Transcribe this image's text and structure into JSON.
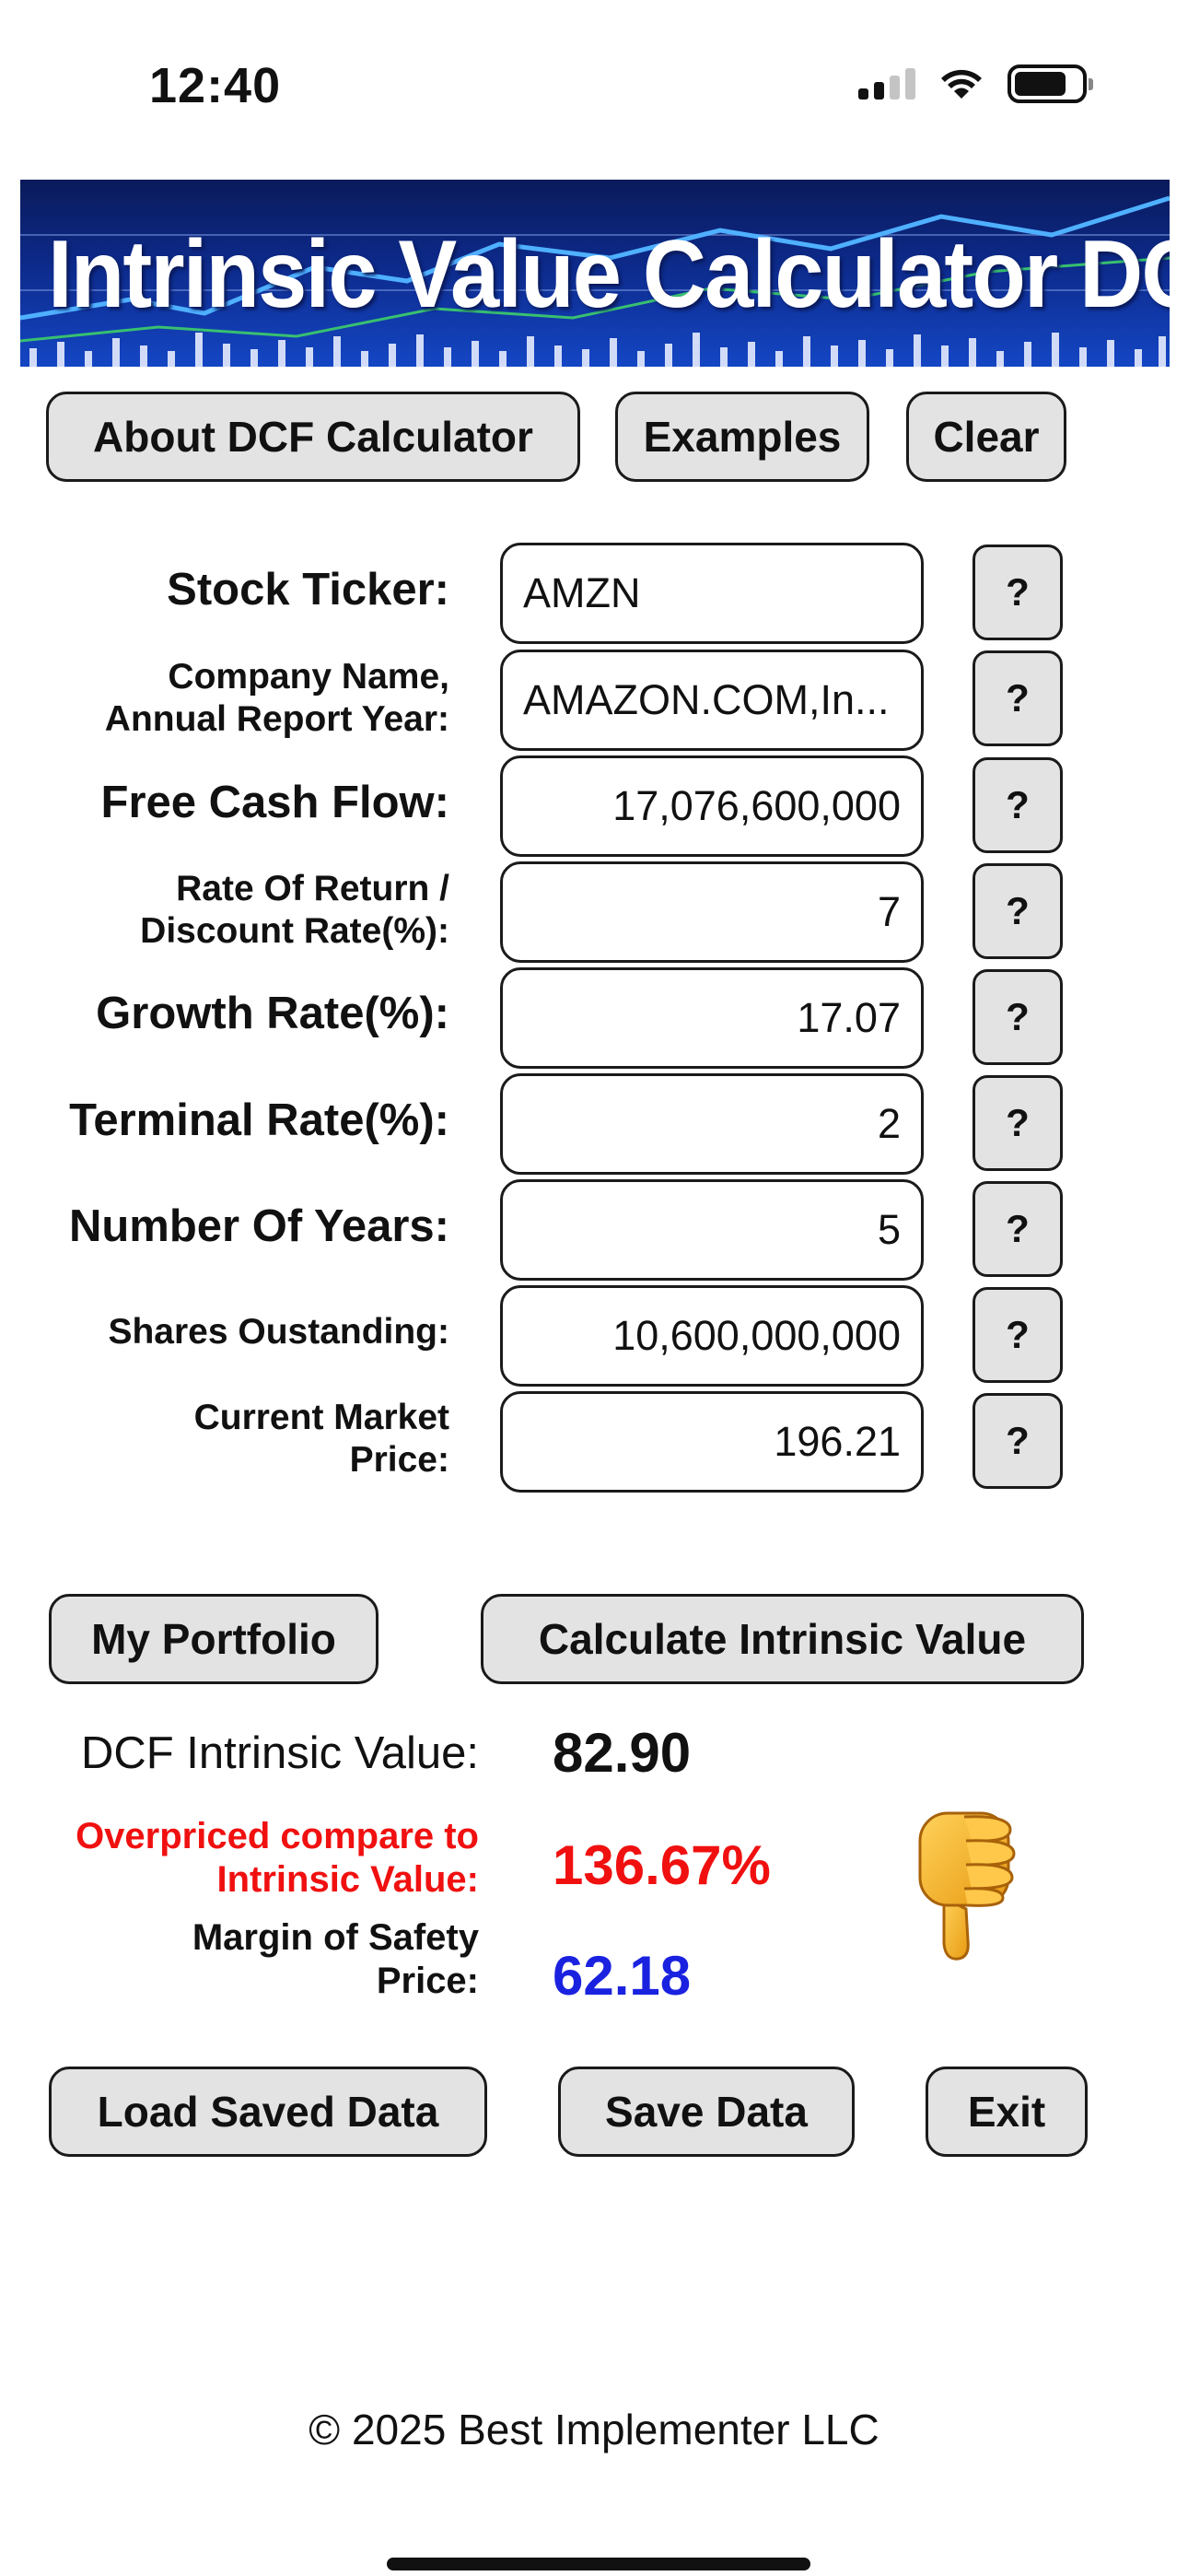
{
  "status_bar": {
    "time": "12:40"
  },
  "banner": {
    "title": "Intrinsic Value Calculator DCF"
  },
  "top_buttons": {
    "about": "About DCF Calculator",
    "examples": "Examples",
    "clear": "Clear"
  },
  "help_label": "?",
  "form": {
    "ticker_label": "Stock Ticker:",
    "ticker_value": "AMZN",
    "company_label_1": "Company Name,",
    "company_label_2": "Annual Report Year:",
    "company_value": "AMAZON.COM,In...",
    "fcf_label": "Free Cash Flow:",
    "fcf_value": "17,076,600,000",
    "rate_label_1": "Rate Of Return /",
    "rate_label_2": "Discount Rate(%):",
    "rate_value": "7",
    "growth_label": "Growth Rate(%):",
    "growth_value": "17.07",
    "terminal_label": "Terminal Rate(%):",
    "terminal_value": "2",
    "years_label": "Number Of Years:",
    "years_value": "5",
    "shares_label": "Shares Oustanding:",
    "shares_value": "10,600,000,000",
    "price_label_1": "Current Market",
    "price_label_2": "Price:",
    "price_value": "196.21"
  },
  "action_buttons": {
    "portfolio": "My Portfolio",
    "calculate": "Calculate Intrinsic Value"
  },
  "results": {
    "dcf_label": "DCF Intrinsic Value:",
    "dcf_value": "82.90",
    "over_label_1": "Overpriced compare to",
    "over_label_2": "Intrinsic Value:",
    "over_value": "136.67%",
    "mos_label_1": "Margin of Safety",
    "mos_label_2": "Price:",
    "mos_value": "62.18",
    "verdict_icon": "thumbs-down-icon"
  },
  "bottom_buttons": {
    "load": "Load Saved Data",
    "save": "Save Data",
    "exit": "Exit"
  },
  "footer": {
    "copyright": "© 2025 Best Implementer LLC"
  },
  "colors": {
    "overpriced": "#f01010",
    "margin_of_safety": "#1a22e0",
    "button_bg": "#e3e3e3",
    "banner_blue": "#0d2a8a"
  }
}
